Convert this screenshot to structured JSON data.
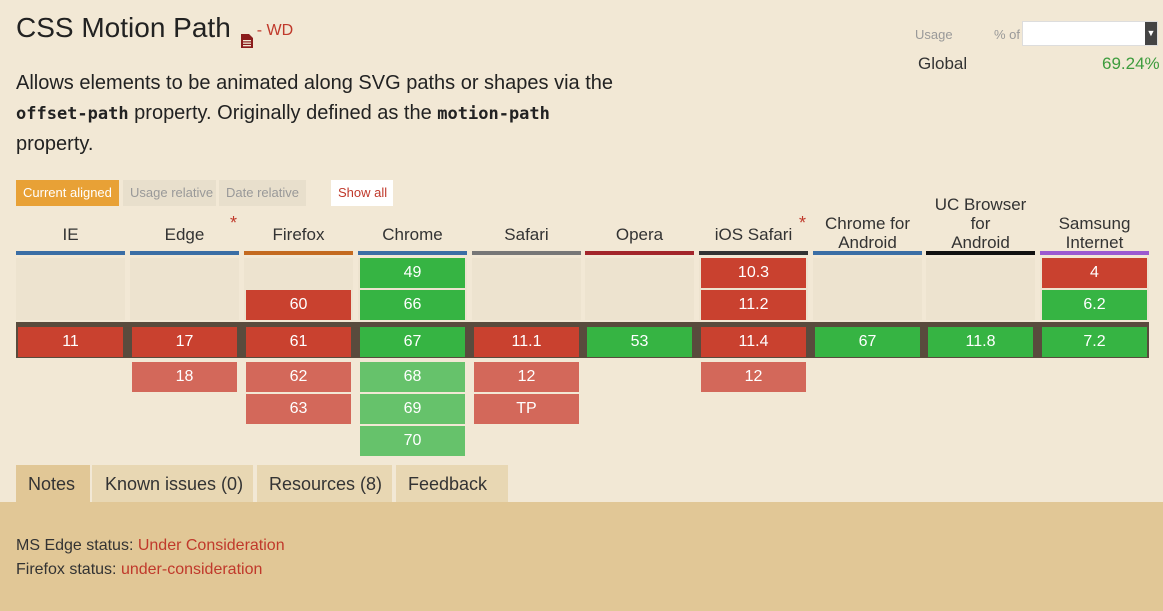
{
  "title": "CSS Motion Path",
  "spec_status": "- WD",
  "description": {
    "part1": "Allows elements to be animated along SVG paths or shapes via the",
    "code1": "offset-path",
    "part2": "property. Originally defined as the",
    "code2": "motion-path",
    "part3": "property."
  },
  "usage": {
    "label": "Usage",
    "pct_of": "% of",
    "global_label": "Global",
    "global_value": "69.24%"
  },
  "view_buttons": {
    "current_aligned": "Current aligned",
    "usage_relative": "Usage relative",
    "date_relative": "Date relative",
    "show_all": "Show all"
  },
  "browsers": [
    {
      "name": "IE",
      "line2": "",
      "asterisk": "",
      "bar_color": "#3b6ea5",
      "before": [],
      "current": {
        "v": "11",
        "s": "n"
      },
      "after": []
    },
    {
      "name": "Edge",
      "line2": "",
      "asterisk": "*",
      "bar_color": "#3b6ea5",
      "before": [],
      "current": {
        "v": "17",
        "s": "n"
      },
      "after": [
        {
          "v": "18",
          "s": "nf"
        }
      ]
    },
    {
      "name": "Firefox",
      "line2": "",
      "asterisk": "",
      "bar_color": "#c46a1f",
      "before": [
        {
          "v": "60",
          "s": "n"
        }
      ],
      "current": {
        "v": "61",
        "s": "n"
      },
      "after": [
        {
          "v": "62",
          "s": "nf"
        },
        {
          "v": "63",
          "s": "nf"
        }
      ]
    },
    {
      "name": "Chrome",
      "line2": "",
      "asterisk": "",
      "bar_color": "#3b6ea5",
      "before": [
        {
          "v": "49",
          "s": "y"
        },
        {
          "v": "66",
          "s": "y"
        }
      ],
      "current": {
        "v": "67",
        "s": "y"
      },
      "after": [
        {
          "v": "68",
          "s": "yf"
        },
        {
          "v": "69",
          "s": "yf"
        },
        {
          "v": "70",
          "s": "yf"
        }
      ]
    },
    {
      "name": "Safari",
      "line2": "",
      "asterisk": "",
      "bar_color": "#777777",
      "before": [],
      "current": {
        "v": "11.1",
        "s": "n"
      },
      "after": [
        {
          "v": "12",
          "s": "nf"
        },
        {
          "v": "TP",
          "s": "nf"
        }
      ]
    },
    {
      "name": "Opera",
      "line2": "",
      "asterisk": "",
      "bar_color": "#a3252a",
      "before": [],
      "current": {
        "v": "53",
        "s": "y"
      },
      "after": []
    },
    {
      "name": "iOS Safari",
      "line2": "",
      "asterisk": "*",
      "bar_color": "#333333",
      "before": [
        {
          "v": "10.3",
          "s": "n"
        },
        {
          "v": "11.2",
          "s": "n"
        }
      ],
      "current": {
        "v": "11.4",
        "s": "n"
      },
      "after": [
        {
          "v": "12",
          "s": "nf"
        }
      ]
    },
    {
      "name": "Chrome for",
      "line2": "Android",
      "asterisk": "",
      "bar_color": "#3b6ea5",
      "before": [],
      "current": {
        "v": "67",
        "s": "y"
      },
      "after": []
    },
    {
      "name": "UC Browser for",
      "line2": "Android",
      "asterisk": "",
      "bar_color": "#111111",
      "before": [],
      "current": {
        "v": "11.8",
        "s": "y"
      },
      "after": []
    },
    {
      "name": "Samsung",
      "line2": "Internet",
      "asterisk": "",
      "bar_color": "#9b59d0",
      "before": [
        {
          "v": "4",
          "s": "n"
        },
        {
          "v": "6.2",
          "s": "y"
        }
      ],
      "current": {
        "v": "7.2",
        "s": "y"
      },
      "after": []
    }
  ],
  "tabs": {
    "notes": "Notes",
    "known_issues": "Known issues (0)",
    "resources": "Resources (8)",
    "feedback": "Feedback"
  },
  "notes": {
    "edge_label": "MS Edge status:",
    "edge_value": "Under Consideration",
    "firefox_label": "Firefox status:",
    "firefox_value": "under-consideration"
  },
  "colors": {
    "supported": "#36b443",
    "unsupported": "#c9412f",
    "accent": "#e8a136",
    "link": "#c0392b"
  }
}
